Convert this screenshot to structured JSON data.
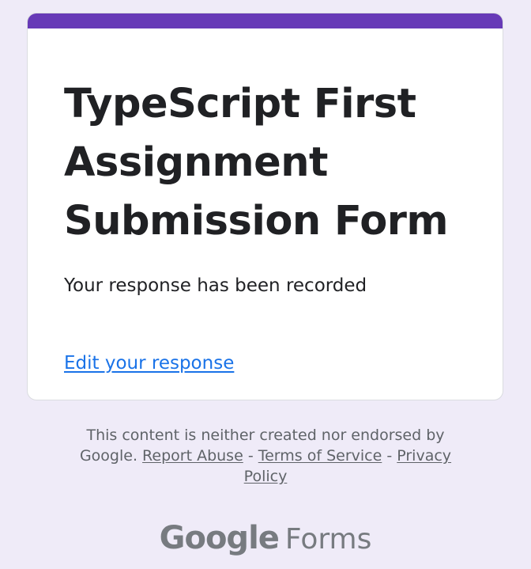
{
  "form": {
    "title": "TypeScript First Assignment Submission Form",
    "confirmation_message": "Your response has been recorded",
    "edit_response_link": "Edit your response"
  },
  "footer": {
    "disclaimer_prefix": "This content is neither created nor endorsed by Google.",
    "report_abuse": "Report Abuse",
    "separator": "-",
    "terms_of_service": "Terms of Service",
    "privacy_policy": "Privacy Policy"
  },
  "branding": {
    "logo_google": "Google",
    "logo_forms": "Forms"
  },
  "colors": {
    "accent": "#673ab7",
    "background": "#efebf8",
    "link": "#1a73e8",
    "text": "#202124",
    "muted_text": "#5f6368"
  }
}
